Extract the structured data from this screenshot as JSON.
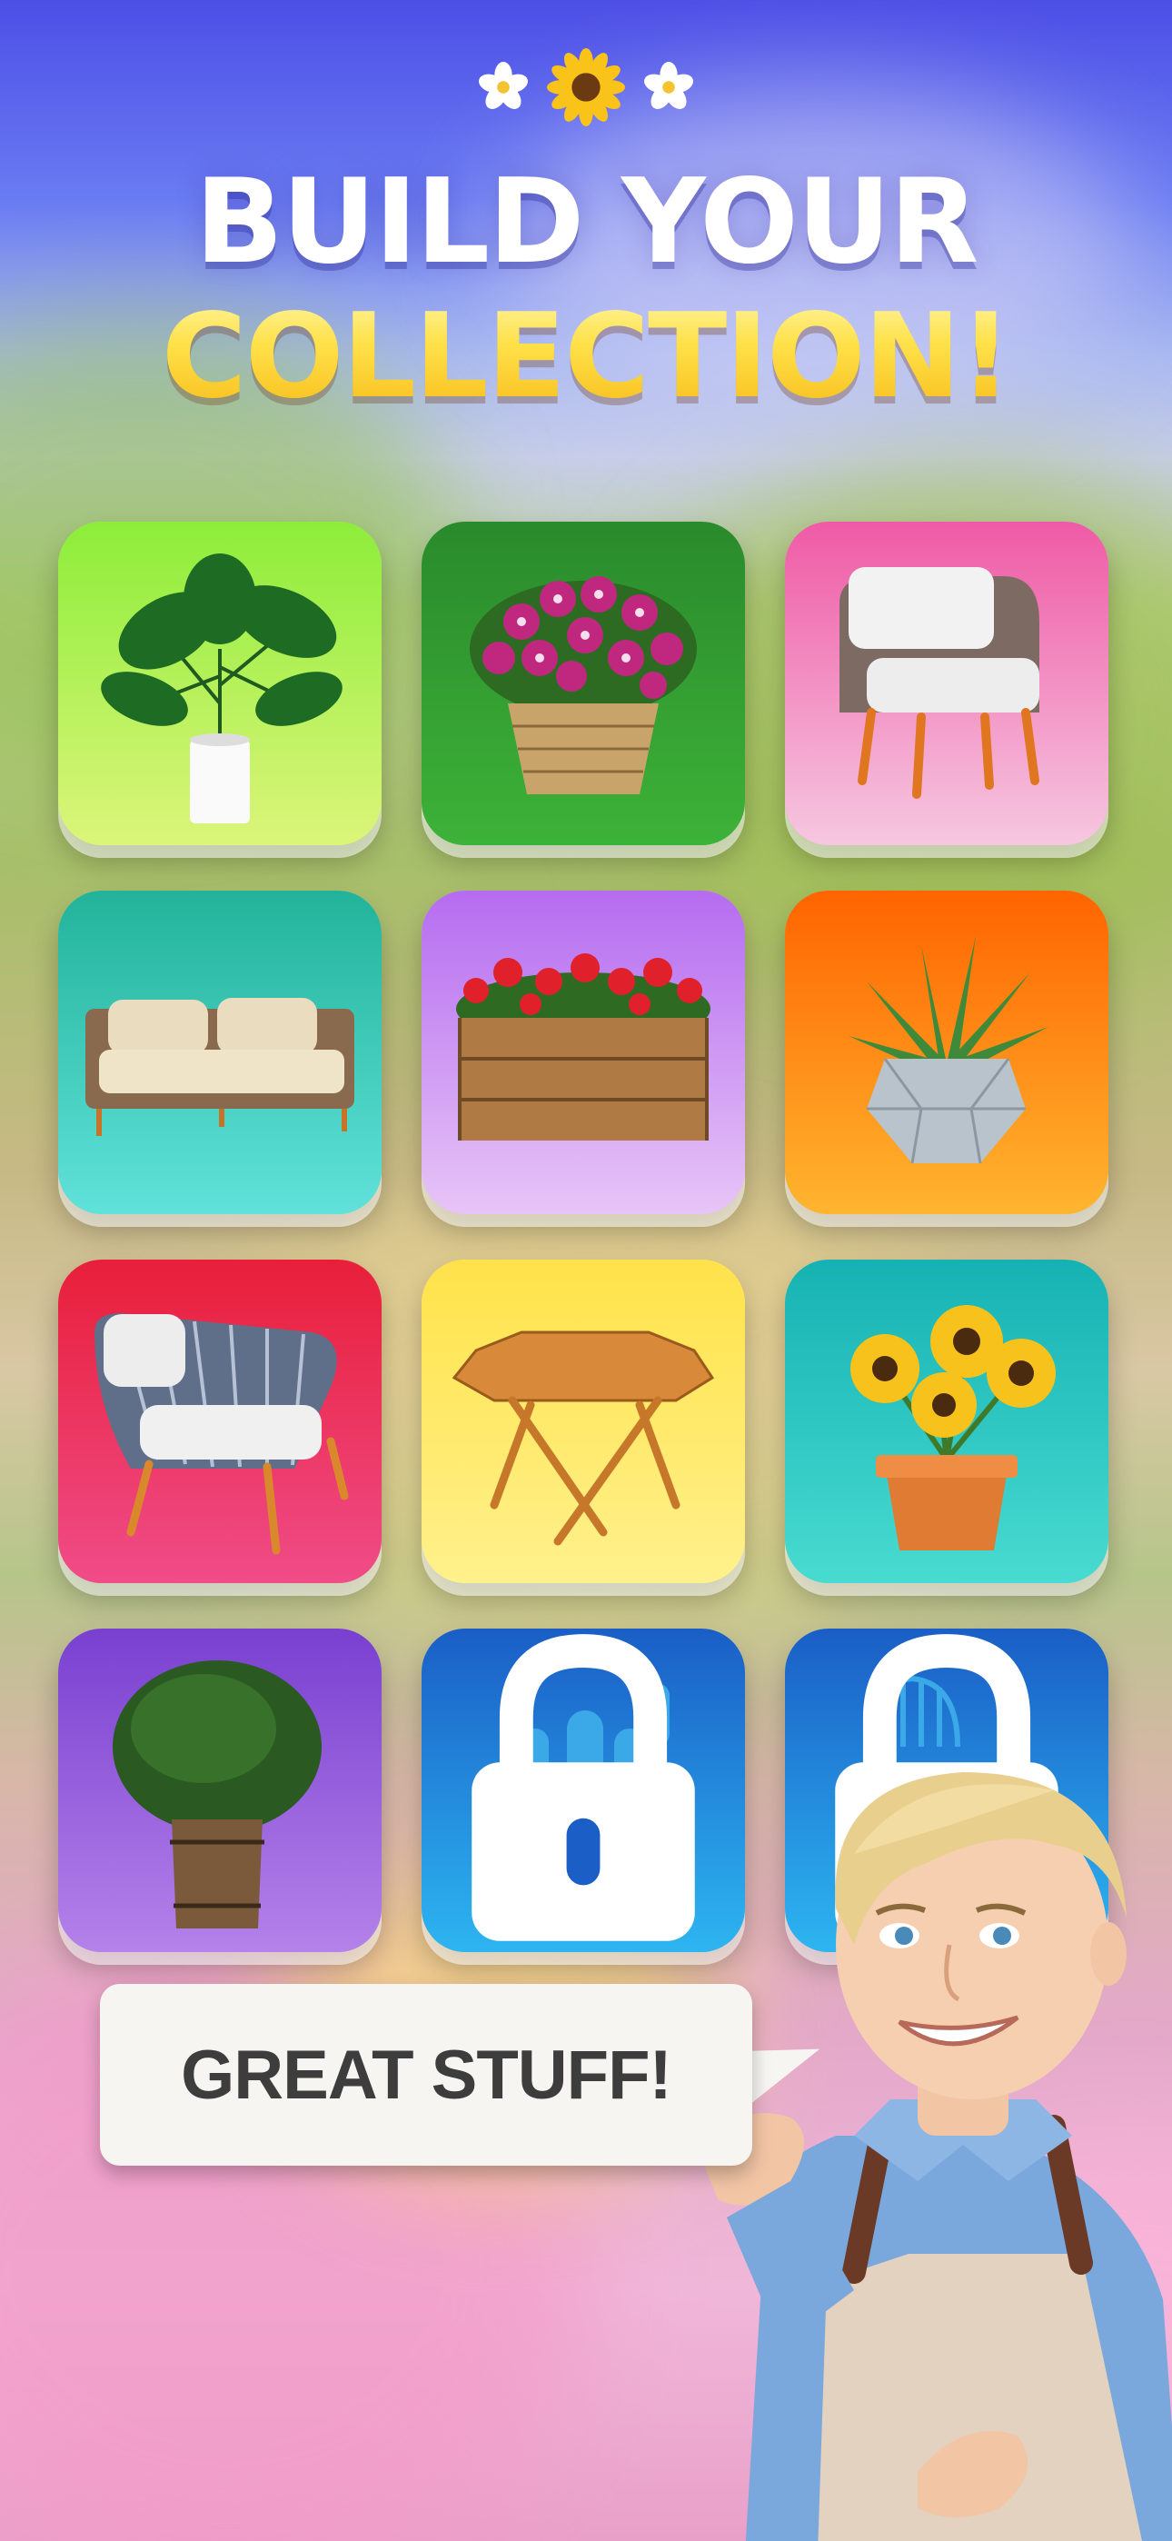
{
  "header": {
    "title_line1": "BUILD YOUR",
    "title_line2": "COLLECTION!",
    "deco_icons": [
      "white-flower-icon",
      "sunflower-icon",
      "white-flower-icon"
    ]
  },
  "collection": {
    "items": [
      {
        "name": "monstera-plant",
        "icon": "monstera-icon",
        "bg_top": "#9cf04a",
        "bg_bottom": "#d8f56a",
        "locked": false
      },
      {
        "name": "petunia-basket",
        "icon": "petunia-basket-icon",
        "bg_top": "#2e8a2e",
        "bg_bottom": "#3fae3a",
        "locked": false
      },
      {
        "name": "wicker-armchair",
        "icon": "armchair-icon",
        "bg_top": "#f05aa5",
        "bg_bottom": "#f6c3dd",
        "locked": false
      },
      {
        "name": "outdoor-sofa",
        "icon": "sofa-icon",
        "bg_top": "#23b39a",
        "bg_bottom": "#5fe0d8",
        "locked": false
      },
      {
        "name": "geranium-crate",
        "icon": "flower-crate-icon",
        "bg_top": "#b36cf0",
        "bg_bottom": "#e5c2f5",
        "locked": false
      },
      {
        "name": "aloe-pot",
        "icon": "aloe-icon",
        "bg_top": "#ff6a00",
        "bg_bottom": "#ffb22e",
        "locked": false
      },
      {
        "name": "string-chair",
        "icon": "string-chair-icon",
        "bg_top": "#e8203a",
        "bg_bottom": "#f0508a",
        "locked": false
      },
      {
        "name": "folding-table",
        "icon": "table-icon",
        "bg_top": "#ffe14a",
        "bg_bottom": "#fff08a",
        "locked": false
      },
      {
        "name": "sunflower-pot",
        "icon": "sunflower-pot-icon",
        "bg_top": "#17b3b3",
        "bg_bottom": "#45d9d0",
        "locked": false
      },
      {
        "name": "boxwood-barrel",
        "icon": "boxwood-icon",
        "bg_top": "#7a3fd0",
        "bg_bottom": "#b27ee8",
        "locked": false
      },
      {
        "name": "cactus-pot",
        "icon": "cactus-icon",
        "bg_top": "#1a5fc7",
        "bg_bottom": "#2bb3f0",
        "locked": true
      },
      {
        "name": "garden-chair",
        "icon": "chair-icon",
        "bg_top": "#1a5fc7",
        "bg_bottom": "#2bb3f0",
        "locked": true
      }
    ]
  },
  "speech": {
    "text": "GREAT STUFF!"
  },
  "character": {
    "icon": "gardener-host-avatar"
  }
}
